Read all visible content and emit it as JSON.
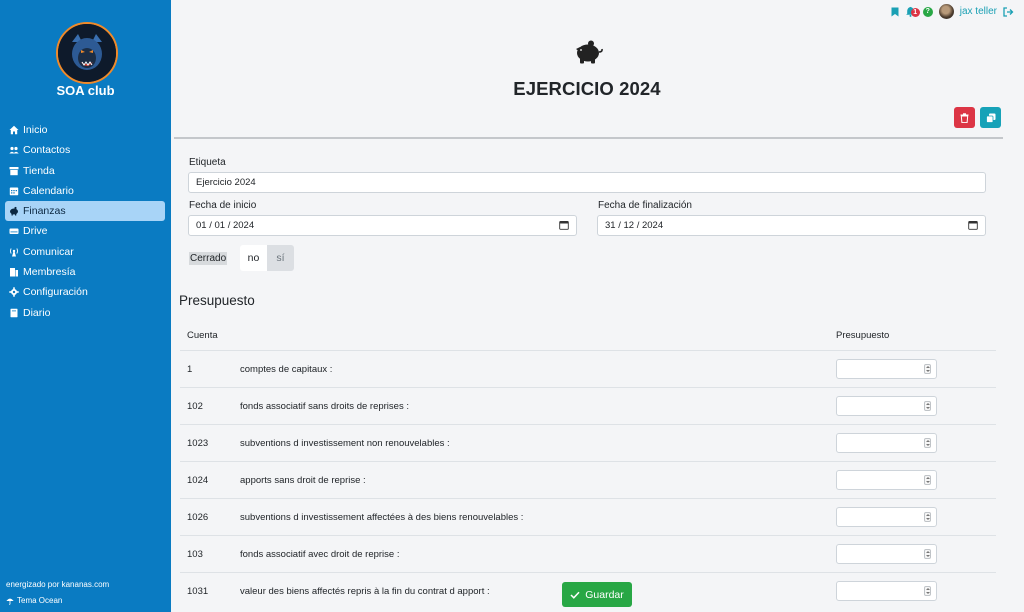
{
  "sidebar": {
    "club_name": "SOA club",
    "items": [
      {
        "label": "Inicio",
        "icon": "home-icon"
      },
      {
        "label": "Contactos",
        "icon": "users-icon"
      },
      {
        "label": "Tienda",
        "icon": "store-icon"
      },
      {
        "label": "Calendario",
        "icon": "calendar-icon"
      },
      {
        "label": "Finanzas",
        "icon": "piggy-bank-icon",
        "active": true
      },
      {
        "label": "Drive",
        "icon": "drive-icon"
      },
      {
        "label": "Comunicar",
        "icon": "broadcast-icon"
      },
      {
        "label": "Membresía",
        "icon": "membership-icon"
      },
      {
        "label": "Configuración",
        "icon": "gear-icon"
      },
      {
        "label": "Diario",
        "icon": "book-icon"
      }
    ],
    "powered_by": "energizado por kananas.com",
    "theme": "Tema Ocean"
  },
  "topbar": {
    "notification_count": "1",
    "help_symbol": "?",
    "username": "jax teller"
  },
  "header": {
    "title": "EJERCICIO 2024"
  },
  "form": {
    "label_label": "Etiqueta",
    "label_value": "Ejercicio 2024",
    "start_label": "Fecha de inicio",
    "start_value": "01 / 01 / 2024",
    "end_label": "Fecha de finalización",
    "end_value": "31 / 12 / 2024",
    "closed_label": "Cerrado",
    "closed_no": "no",
    "closed_yes": "sí"
  },
  "budget": {
    "title": "Presupuesto",
    "col_account": "Cuenta",
    "col_budget": "Presupuesto",
    "rows": [
      {
        "code": "1",
        "name": "comptes de capitaux :"
      },
      {
        "code": "102",
        "name": "fonds associatif sans droits de reprises :"
      },
      {
        "code": "1023",
        "name": "subventions d investissement non renouvelables :"
      },
      {
        "code": "1024",
        "name": "apports sans droit de reprise :"
      },
      {
        "code": "1026",
        "name": "subventions d investissement affectées à des biens renouvelables :"
      },
      {
        "code": "103",
        "name": "fonds associatif avec droit de reprise :"
      },
      {
        "code": "1031",
        "name": "valeur des biens affectés repris à la fin du contrat d apport :"
      }
    ]
  },
  "actions": {
    "save_label": "Guardar"
  },
  "colors": {
    "sidebar": "#0a7bc2",
    "active_item": "#a8d4f7",
    "danger": "#dc3545",
    "info": "#17a2b8",
    "success": "#28a745"
  }
}
